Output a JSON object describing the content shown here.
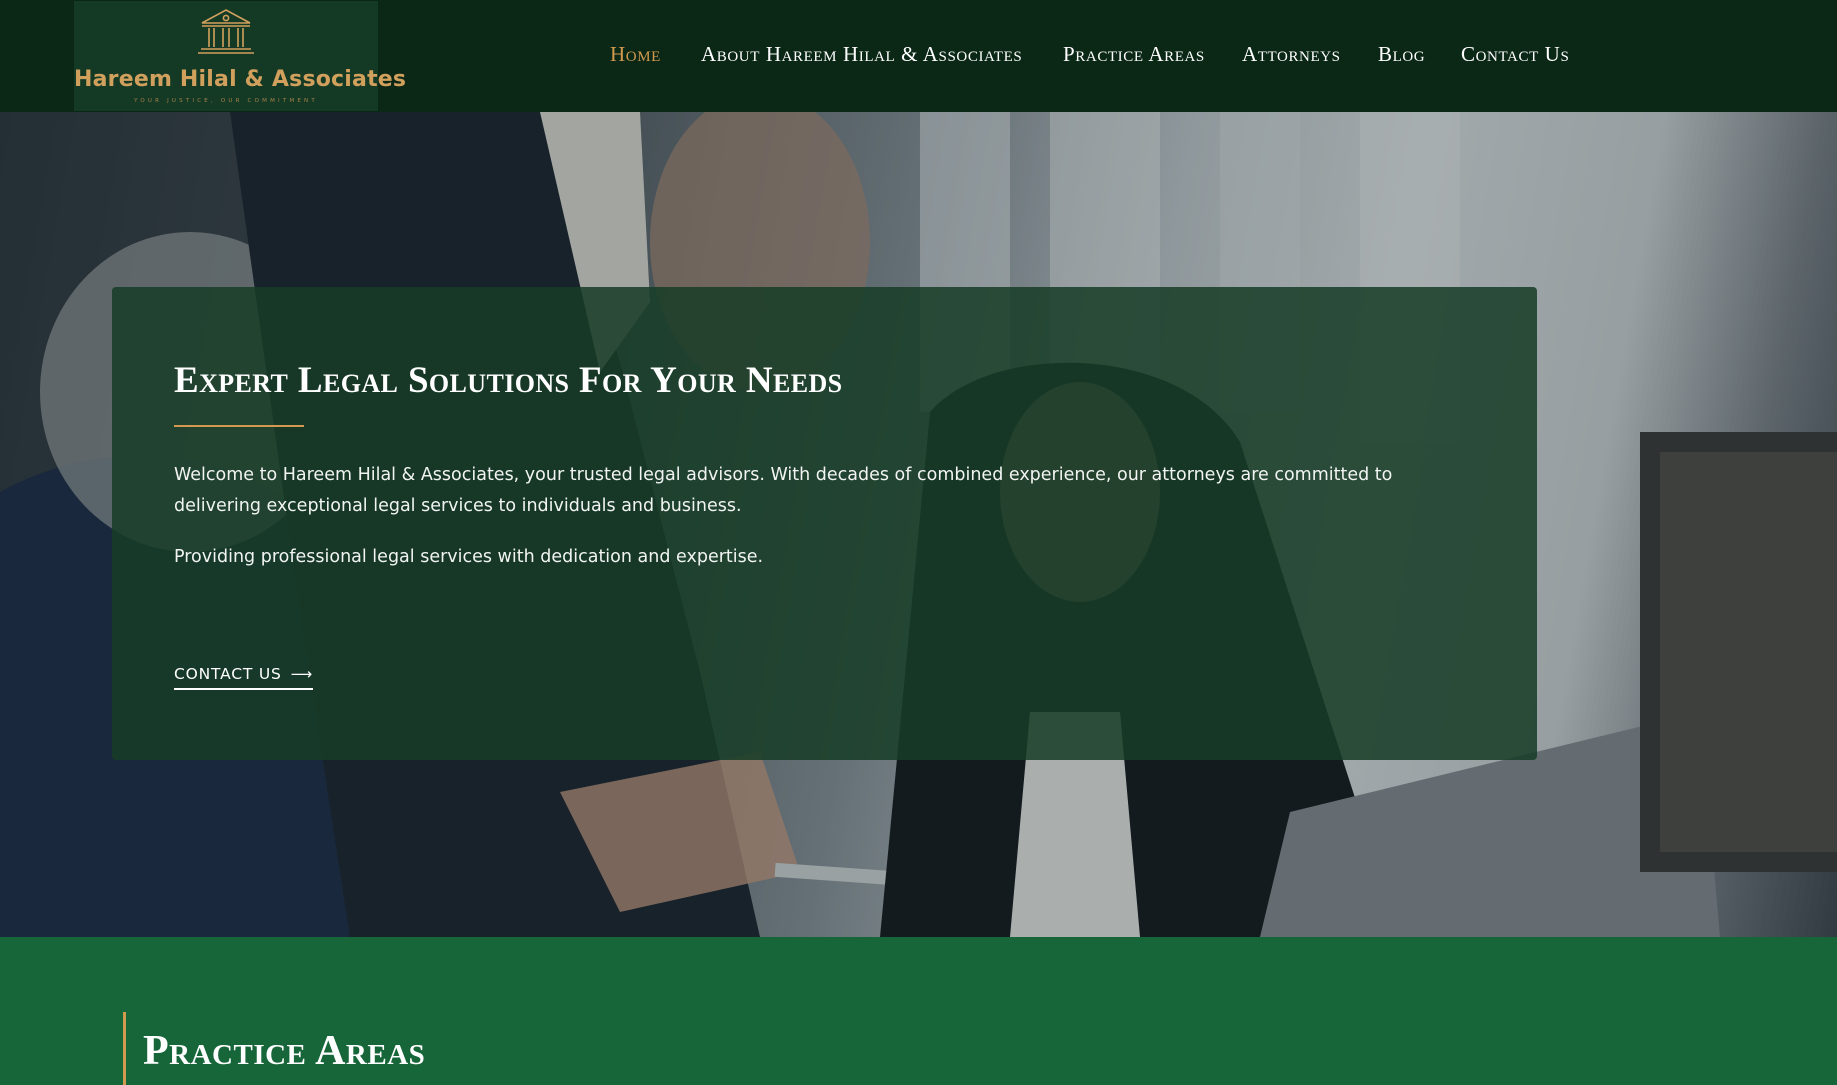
{
  "brand": {
    "name": "Hareem Hilal & Associates",
    "tagline": "Your Justice, Our Commitment",
    "logo_icon": "courthouse-icon",
    "primary_color": "#0b2716",
    "accent_color": "#d39a4f",
    "section_color": "#17663a"
  },
  "nav": {
    "items": [
      {
        "label": "Home",
        "active": true
      },
      {
        "label": "About Hareem Hilal & Associates",
        "active": false
      },
      {
        "label": "Practice Areas",
        "active": false
      },
      {
        "label": "Attorneys",
        "active": false
      },
      {
        "label": "Blog",
        "active": false
      },
      {
        "label": "Contact Us",
        "active": false
      }
    ]
  },
  "hero": {
    "title": "Expert Legal Solutions For Your Needs",
    "paragraph1": "Welcome to Hareem Hilal & Associates,  your trusted legal advisors. With decades of combined experience, our attorneys are committed to delivering exceptional legal services to individuals and business.",
    "paragraph2": "Providing professional legal services with dedication and expertise.",
    "cta_label": "CONTACT US",
    "cta_icon": "arrow-right-icon"
  },
  "practice": {
    "title": "Practice Areas"
  }
}
